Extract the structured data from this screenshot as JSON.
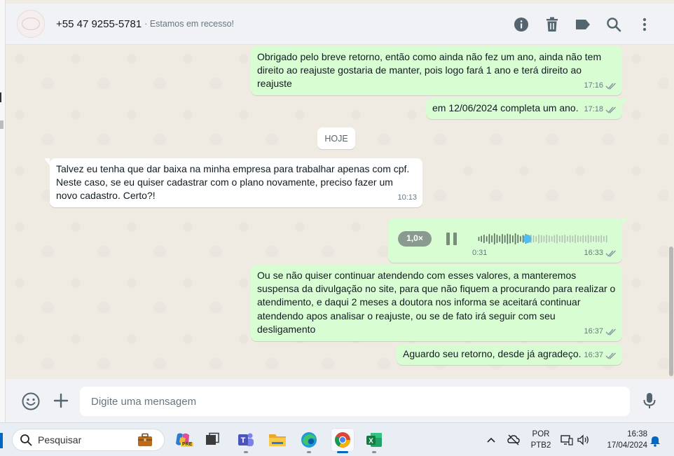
{
  "header": {
    "contact_number": "+55 47 9255-5781",
    "contact_status": "· Estamos em recesso!",
    "icons": [
      "info-icon",
      "trash-icon",
      "label-icon",
      "search-icon",
      "menu-dots-icon"
    ]
  },
  "messages": {
    "m1": {
      "text": "Obrigado pelo breve retorno, então como ainda não fez um ano, ainda não tem direito ao reajuste gostaria de manter, pois logo fará 1 ano e terá direito ao reajuste",
      "time": "17:16"
    },
    "m2": {
      "text": "em 12/06/2024 completa um ano.",
      "time": "17:18"
    },
    "date_chip": "HOJE",
    "m3": {
      "text": "Talvez eu tenha que dar baixa na minha empresa para trabalhar apenas com cpf. Neste caso, se eu quiser cadastrar com o plano novamente, preciso fazer um novo cadastro. Certo?!",
      "time": "10:13"
    },
    "voice": {
      "speed": "1,0×",
      "duration": "0:31",
      "time": "16:33",
      "progress": 0.38
    },
    "m4": {
      "text": "Ou se não quiser continuar atendendo com esses valores, a manteremos suspensa da divulgação no site, para que não fiquem a procurando para realizar o atendimento, e daqui 2 meses a doutora nos informa se aceitará continuar atendendo apos analisar o reajuste, ou se de fato irá seguir com seu desligamento",
      "time": "16:37"
    },
    "m5": {
      "text": "Aguardo seu retorno, desde já agradeço.",
      "time": "16:37"
    }
  },
  "composer": {
    "placeholder": "Digite uma mensagem"
  },
  "taskbar": {
    "search_text": "Pesquisar",
    "apps": [
      "copilot-icon",
      "task-view-icon",
      "teams-icon",
      "file-explorer-icon",
      "edge-icon",
      "chrome-icon",
      "excel-icon"
    ],
    "active_app": "chrome-icon",
    "language_line1": "POR",
    "language_line2": "PTB2",
    "time": "16:38",
    "date": "17/04/2024"
  },
  "colors": {
    "outgoing_bubble": "#d9fdd3",
    "incoming_bubble": "#ffffff",
    "chat_background": "#efeae2",
    "header_background": "#f0f2f5",
    "read_ticks": "#8696a0",
    "voice_progress": "#53bdeb"
  }
}
